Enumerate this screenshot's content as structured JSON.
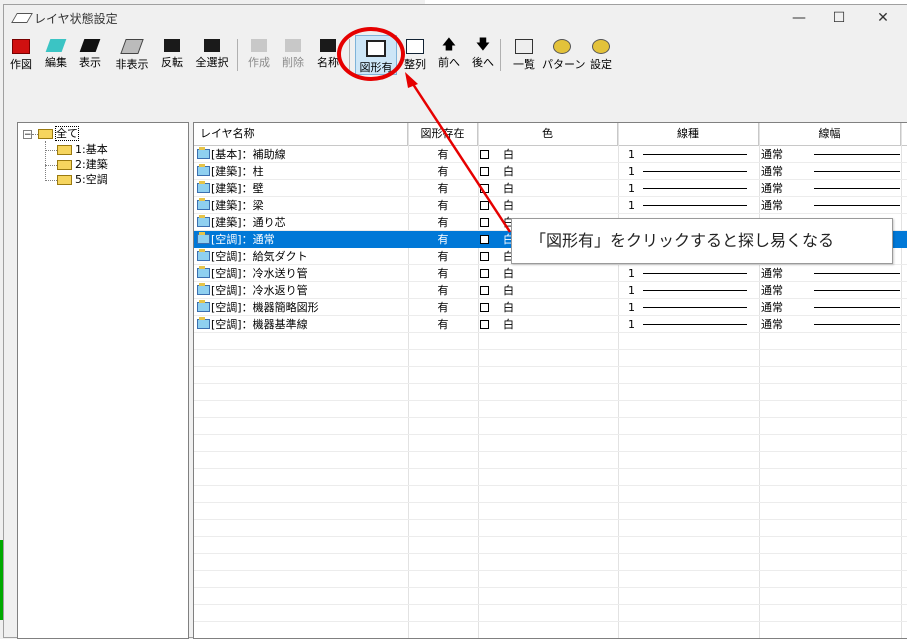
{
  "window": {
    "title": "レイヤ状態設定"
  },
  "toolbar": [
    {
      "label": "作図",
      "icon": "draw-icon"
    },
    {
      "label": "編集",
      "icon": "edit-icon"
    },
    {
      "label": "表示",
      "icon": "show-icon"
    },
    {
      "label": "非表示",
      "icon": "hide-icon"
    },
    {
      "label": "反転",
      "icon": "invert-icon"
    },
    {
      "label": "全選択",
      "icon": "select-all-icon"
    },
    {
      "label": "作成",
      "icon": "create-icon",
      "disabled": true
    },
    {
      "label": "削除",
      "icon": "delete-icon",
      "disabled": true
    },
    {
      "label": "名称",
      "icon": "name-icon"
    },
    {
      "label": "図形有",
      "icon": "has-shape-icon",
      "active": true
    },
    {
      "label": "整列",
      "icon": "sort-icon"
    },
    {
      "label": "前へ",
      "icon": "arrow-up-icon"
    },
    {
      "label": "後へ",
      "icon": "arrow-down-icon"
    },
    {
      "label": "一覧",
      "icon": "list-icon"
    },
    {
      "label": "パターン",
      "icon": "pattern-icon"
    },
    {
      "label": "設定",
      "icon": "settings-icon"
    }
  ],
  "tree": {
    "root": "全て",
    "children": [
      "1:基本",
      "2:建築",
      "5:空調"
    ]
  },
  "grid": {
    "headers": [
      "レイヤ名称",
      "図形存在",
      "色",
      "線種",
      "線幅"
    ],
    "rows": [
      {
        "name": "[基本]：補助線",
        "exists": "有",
        "color": "白",
        "linetype": "1",
        "width": "通常"
      },
      {
        "name": "[建築]：柱",
        "exists": "有",
        "color": "白",
        "linetype": "1",
        "width": "通常"
      },
      {
        "name": "[建築]：壁",
        "exists": "有",
        "color": "白",
        "linetype": "1",
        "width": "通常"
      },
      {
        "name": "[建築]：梁",
        "exists": "有",
        "color": "白",
        "linetype": "1",
        "width": "通常"
      },
      {
        "name": "[建築]：通り芯",
        "exists": "有",
        "color": "白",
        "linetype": "",
        "width": ""
      },
      {
        "name": "[空調]：通常",
        "exists": "有",
        "color": "白",
        "linetype": "",
        "width": "",
        "selected": true
      },
      {
        "name": "[空調]：給気ダクト",
        "exists": "有",
        "color": "白",
        "linetype": "",
        "width": ""
      },
      {
        "name": "[空調]：冷水送り管",
        "exists": "有",
        "color": "白",
        "linetype": "1",
        "width": "通常"
      },
      {
        "name": "[空調]：冷水返り管",
        "exists": "有",
        "color": "白",
        "linetype": "1",
        "width": "通常"
      },
      {
        "name": "[空調]：機器簡略図形",
        "exists": "有",
        "color": "白",
        "linetype": "1",
        "width": "通常"
      },
      {
        "name": "[空調]：機器基準線",
        "exists": "有",
        "color": "白",
        "linetype": "1",
        "width": "通常"
      }
    ]
  },
  "annotation": {
    "callout": "「図形有」をクリックすると探し易くなる",
    "highlight_color": "#e60000"
  },
  "colors": {
    "selection": "#0078d7"
  }
}
